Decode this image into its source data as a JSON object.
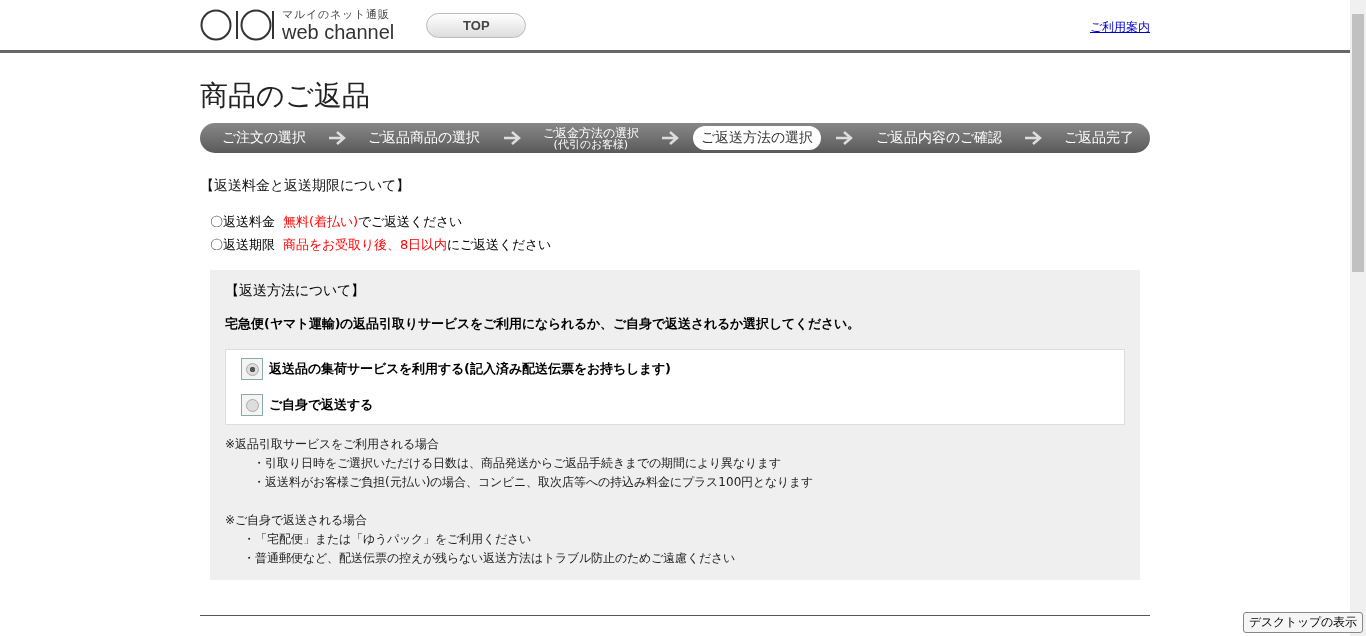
{
  "header": {
    "tagline": "マルイのネット通販",
    "brand": "web channel",
    "top_button": "TOP",
    "guide_link": "ご利用案内"
  },
  "page_title": "商品のご返品",
  "steps": [
    {
      "label": "ご注文の選択",
      "selected": false
    },
    {
      "label": "ご返品商品の選択",
      "selected": false
    },
    {
      "label": "ご返金方法の選択",
      "sub": "(代引のお客様)",
      "selected": false
    },
    {
      "label": "ご返送方法の選択",
      "selected": true
    },
    {
      "label": "ご返品内容のご確認",
      "selected": false
    },
    {
      "label": "ご返品完了",
      "selected": false
    }
  ],
  "fee_section": {
    "heading": "【返送料金と返送期限について】",
    "rows": [
      {
        "label": "〇返送料金",
        "emphasis": "無料(着払い)",
        "rest": "でご返送ください"
      },
      {
        "label": "〇返送期限",
        "emphasis": "商品をお受取り後、8日以内",
        "rest": "にご返送ください"
      }
    ]
  },
  "method_section": {
    "heading": "【返送方法について】",
    "instruction": "宅急便(ヤマト運輸)の返品引取りサービスをご利用になられるか、ご自身で返送されるか選択してください。",
    "options": [
      {
        "label": "返送品の集荷サービスを利用する(記入済み配送伝票をお持ちします)",
        "selected": true
      },
      {
        "label": "ご自身で返送する",
        "selected": false
      }
    ],
    "notes": [
      {
        "title": "※返品引取サービスをご利用される場合",
        "items": [
          "・引取り日時をご選択いただける日数は、商品発送からご返品手続きまでの期間により異なります",
          "・返送料がお客様ご負担(元払い)の場合、コンビニ、取次店等への持込み料金にプラス100円となります"
        ]
      },
      {
        "title": "※ご自身で返送される場合",
        "items": [
          "・「宅配便」または「ゆうパック」をご利用ください",
          "・普通郵便など、配送伝票の控えが残らない返送方法はトラブル防止のためご遠慮ください"
        ]
      }
    ]
  },
  "desktop_button": "デスクトップの表示"
}
